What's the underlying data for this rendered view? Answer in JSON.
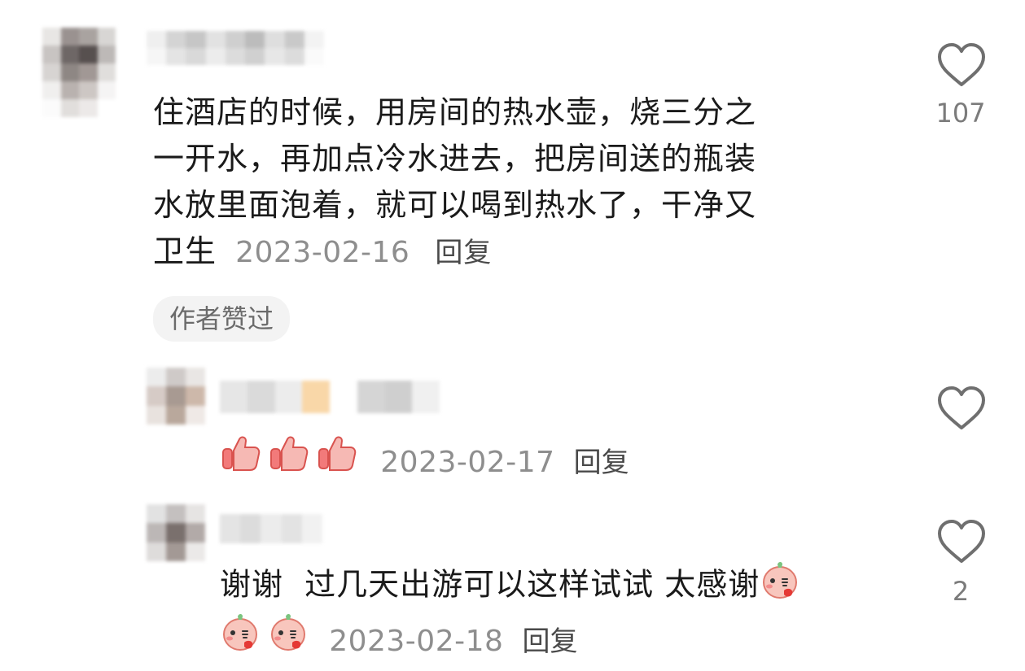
{
  "comments": [
    {
      "text_lines": [
        "住酒店的时候，用房间的热水壶，烧三分之",
        "一开水，再加点冷水进去，把房间送的瓶装",
        "水放里面泡着，就可以喝到热水了，干净又"
      ],
      "last_line": "卫生",
      "date": "2023-02-16",
      "reply_label": "回复",
      "badge": "作者赞过",
      "likes": "107"
    },
    {
      "emojis": [
        "thumbs-up",
        "thumbs-up",
        "thumbs-up"
      ],
      "date": "2023-02-17",
      "reply_label": "回复"
    },
    {
      "text": "谢谢  过几天出游可以这样试试 太感谢",
      "trailing_emoji": "blush-face",
      "emojis_second_line": [
        "blush-face",
        "blush-face"
      ],
      "date": "2023-02-18",
      "reply_label": "回复",
      "likes": "2"
    }
  ],
  "colors": {
    "heart_stroke": "#6f6f6f",
    "meta_gray": "#8e8e8e",
    "badge_bg": "#f3f3f3"
  }
}
